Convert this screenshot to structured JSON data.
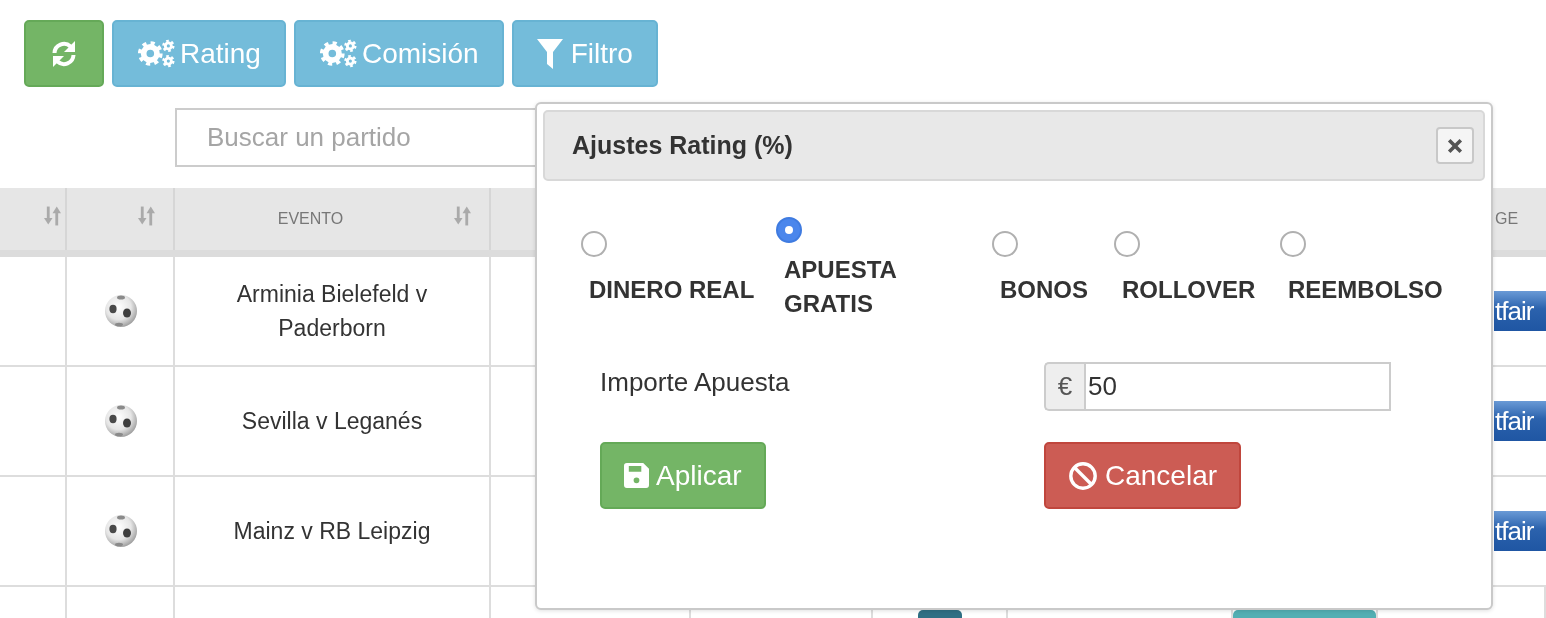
{
  "toolbar": [
    {
      "kind": "refresh"
    },
    {
      "kind": "settings",
      "label": "Rating"
    },
    {
      "kind": "settings",
      "label": "Comisión"
    },
    {
      "kind": "filter",
      "label": "Filtro"
    }
  ],
  "search": {
    "placeholder": "Buscar un partido"
  },
  "table": {
    "columns": [
      {
        "sortable": true
      },
      {
        "sortable": true
      },
      {
        "label": "EVENTO",
        "sortable": true
      },
      {
        "label": "GE",
        "sortable": false
      }
    ],
    "rows": [
      {
        "event": "Arminia Bielefeld v Paderborn",
        "logo": "tfair"
      },
      {
        "event": "Sevilla v Leganés",
        "logo": "tfair"
      },
      {
        "event": "Mainz v RB Leipzig",
        "logo": "tfair"
      }
    ]
  },
  "dialog": {
    "title": "Ajustes Rating (%)",
    "options": [
      {
        "label": "DINERO REAL",
        "selected": false
      },
      {
        "label": "APUESTA GRATIS",
        "selected": true
      },
      {
        "label": "BONOS",
        "selected": false
      },
      {
        "label": "ROLLOVER",
        "selected": false
      },
      {
        "label": "REEMBOLSO",
        "selected": false
      }
    ],
    "amount": {
      "label": "Importe Apuesta",
      "currency": "€",
      "value": "50"
    },
    "buttons": [
      {
        "kind": "apply",
        "label": "Aplicar"
      },
      {
        "kind": "cancel",
        "label": "Cancelar"
      }
    ]
  }
}
